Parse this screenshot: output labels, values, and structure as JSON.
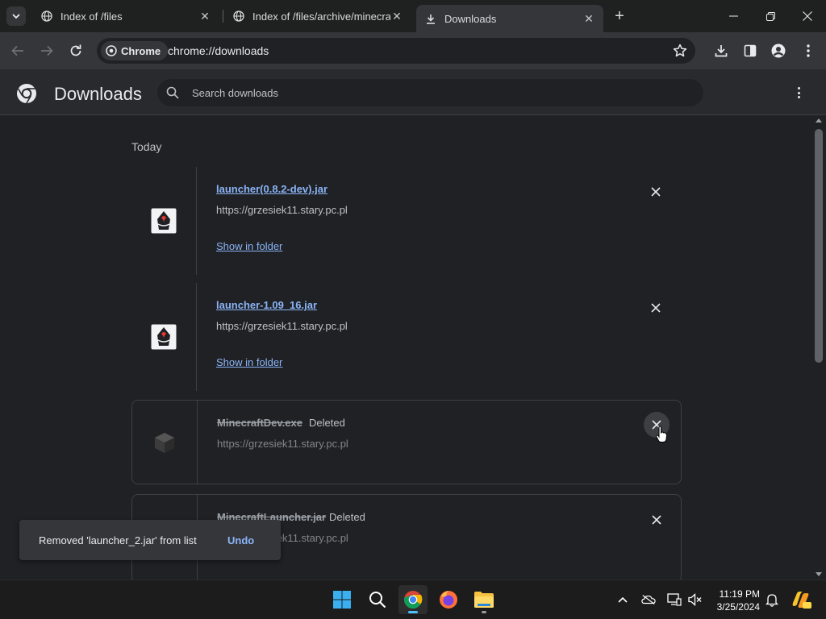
{
  "browser": {
    "tabs": [
      {
        "title": "Index of /files",
        "active": false
      },
      {
        "title": "Index of /files/archive/minecraf",
        "active": false
      },
      {
        "title": "Downloads",
        "active": true
      }
    ],
    "omnibox": {
      "chip_label": "Chrome",
      "url": "chrome://downloads"
    }
  },
  "downloads_page": {
    "title": "Downloads",
    "search_placeholder": "Search downloads",
    "section_label": "Today",
    "items": [
      {
        "name": "launcher(0.8.2-dev).jar",
        "url": "https://grzesiek11.stary.pc.pl",
        "action": "Show in folder",
        "status": "",
        "icon": "java-icon"
      },
      {
        "name": "launcher-1.09_16.jar",
        "url": "https://grzesiek11.stary.pc.pl",
        "action": "Show in folder",
        "status": "",
        "icon": "java-icon"
      },
      {
        "name": "MinecraftDev.exe",
        "url": "https://grzesiek11.stary.pc.pl",
        "action": "",
        "status": "Deleted",
        "icon": "minecraft-block-icon"
      },
      {
        "name": "MinecraftLauncher.jar",
        "url": "https://grzesiek11.stary.pc.pl",
        "action": "",
        "status": "Deleted",
        "icon": "java-icon"
      }
    ]
  },
  "toast": {
    "message": "Removed 'launcher_2.jar' from list",
    "undo_label": "Undo"
  },
  "taskbar": {
    "apps": [
      "start-icon",
      "search-icon",
      "chrome-icon",
      "firefox-icon",
      "file-explorer-icon"
    ],
    "clock": {
      "time": "11:19 PM",
      "date": "3/25/2024"
    }
  },
  "colors": {
    "link": "#8ab4f8",
    "page_bg": "#202124",
    "toolbar": "#35363a",
    "accent": "#4cc2ff"
  }
}
